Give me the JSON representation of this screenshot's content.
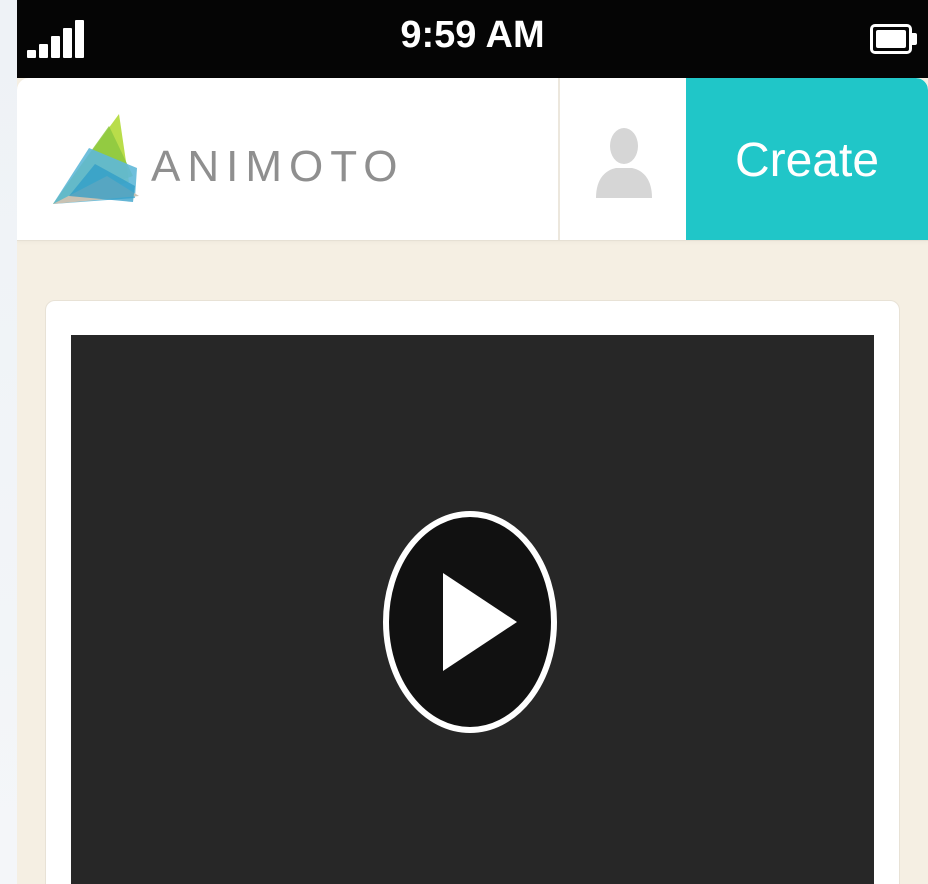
{
  "status_bar": {
    "time": "9:59 AM",
    "signal_icon": "signal-bars-icon",
    "battery_icon": "battery-icon"
  },
  "header": {
    "brand": "ANIMOTO",
    "logo_icon": "animoto-logo-icon",
    "profile_icon": "user-silhouette-icon",
    "create_label": "Create"
  },
  "player": {
    "play_icon": "play-icon"
  },
  "colors": {
    "status_bar_bg": "#050505",
    "accent": "#20c6c8",
    "page_bg": "#f5efe3",
    "video_bg": "#272727",
    "brand_text": "#8f8f8f"
  }
}
